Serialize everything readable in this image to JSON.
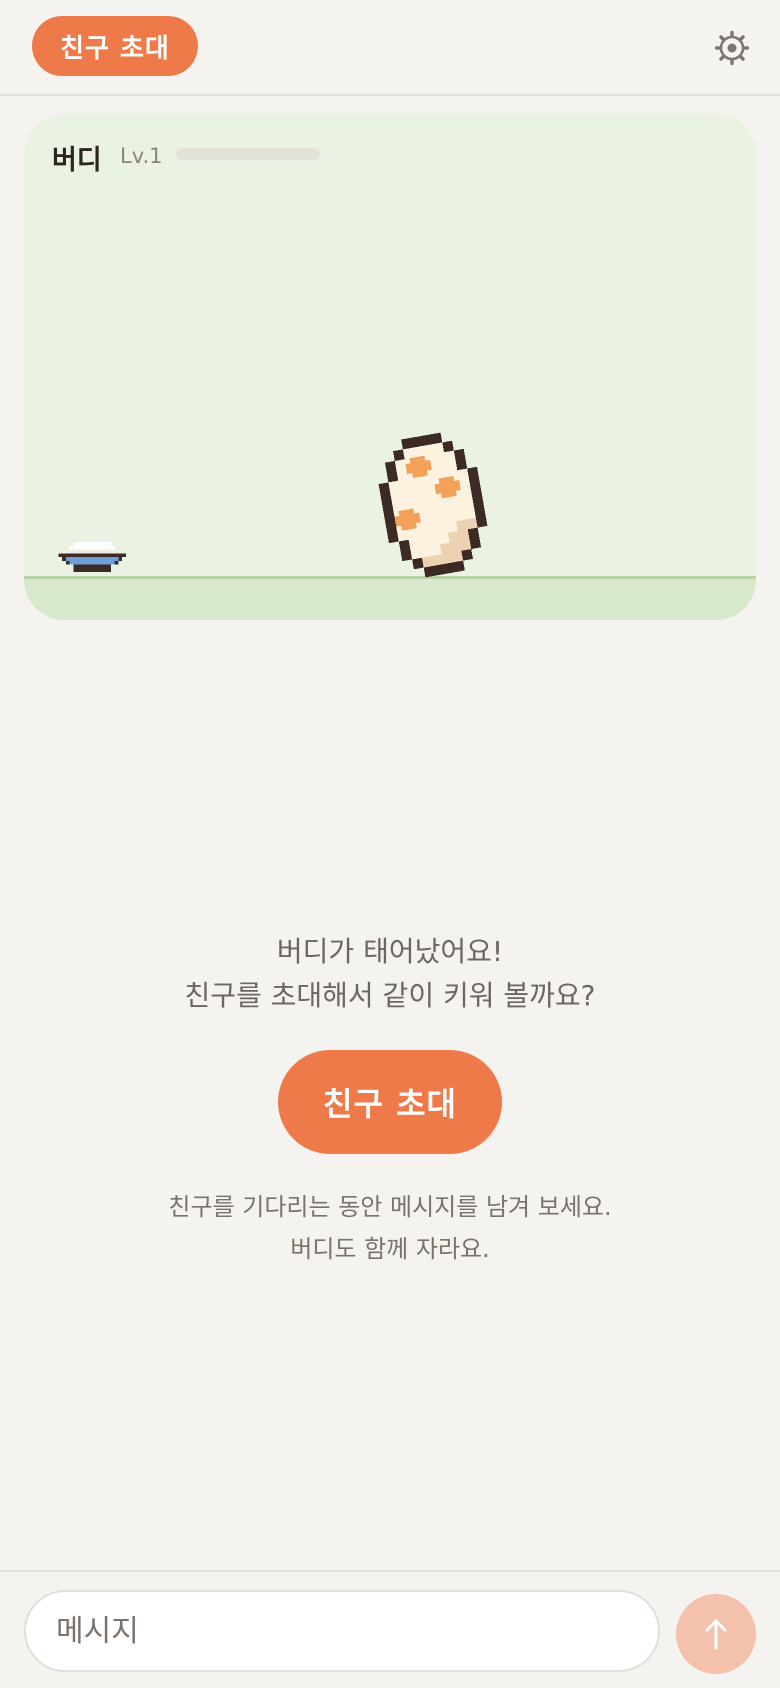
{
  "header": {
    "invite_label": "친구 초대",
    "settings_icon": "gear-icon"
  },
  "pet": {
    "name": "버디",
    "level": "Lv.1",
    "xp_progress": 0,
    "bowl_icon": "food-bowl-icon",
    "egg_icon": "spotted-egg-icon"
  },
  "main": {
    "line1": "버디가 태어났어요!",
    "line2": "친구를 초대해서 같이 키워 볼까요?",
    "invite_button": "친구 초대",
    "hint1": "친구를 기다리는 동안 메시지를 남겨 보세요.",
    "hint2": "버디도 함께 자라요."
  },
  "composer": {
    "placeholder": "메시지",
    "value": "",
    "send_icon": "arrow-up-icon"
  },
  "colors": {
    "accent": "#ee7a4a",
    "background": "#f5f3ef",
    "card": "#eaf2e3",
    "ground": "#d8e8cc",
    "send_disabled": "#f4c1ad"
  }
}
